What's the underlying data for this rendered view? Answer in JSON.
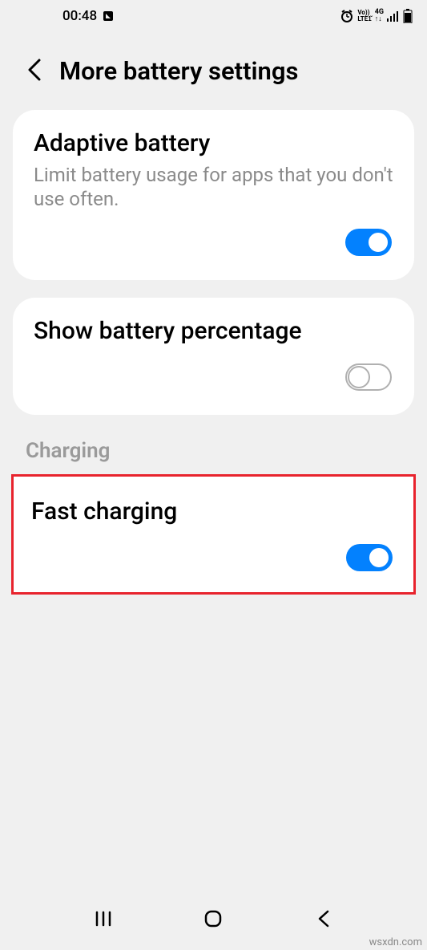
{
  "status": {
    "time": "00:48"
  },
  "header": {
    "title": "More battery settings"
  },
  "adaptive": {
    "title": "Adaptive battery",
    "desc": "Limit battery usage for apps that you don't use often.",
    "on": true
  },
  "percentage": {
    "title": "Show battery percentage",
    "on": false
  },
  "section": {
    "charging": "Charging"
  },
  "fast": {
    "title": "Fast charging",
    "on": true
  },
  "watermark": "wsxdn.com"
}
